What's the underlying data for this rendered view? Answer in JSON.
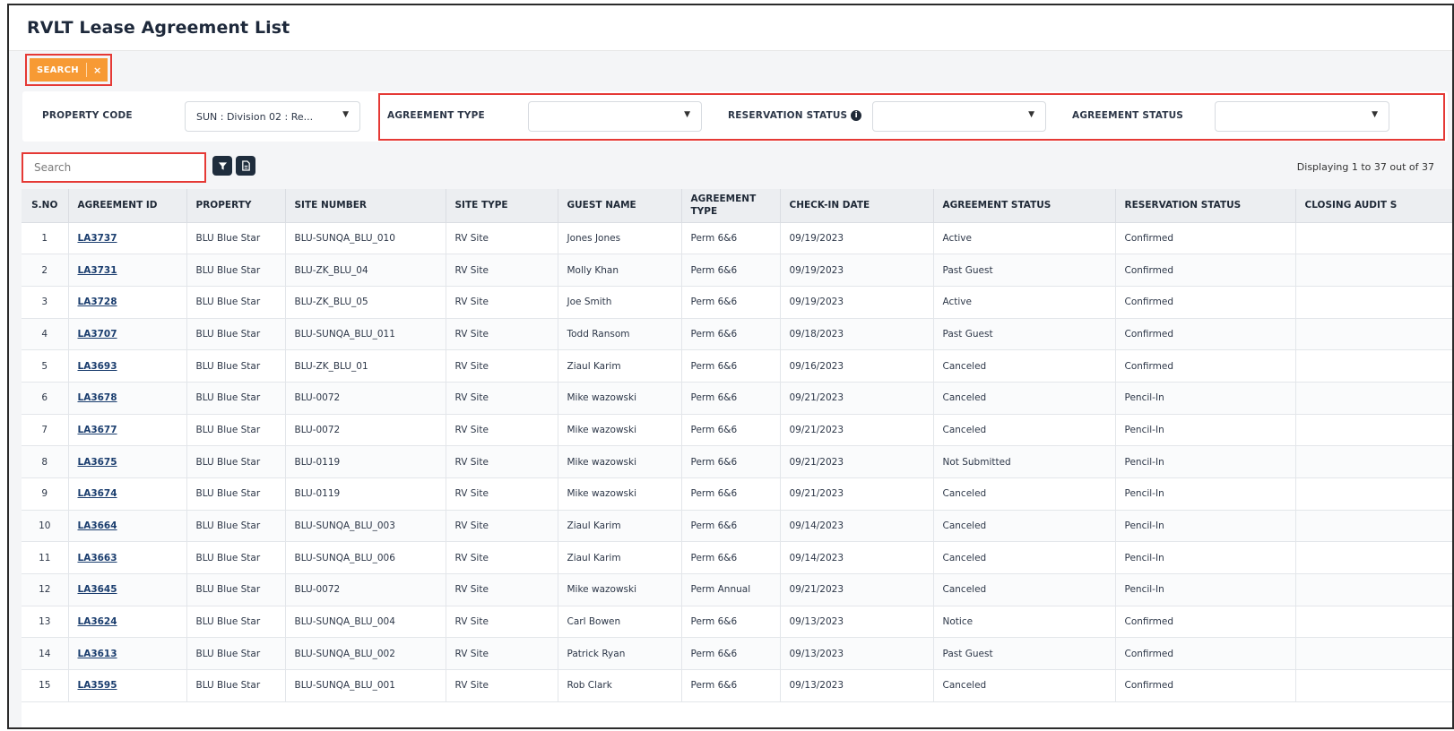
{
  "page": {
    "title": "RVLT Lease Agreement List"
  },
  "search_tab": {
    "label": "SEARCH",
    "close": "×"
  },
  "filters": {
    "property_code": {
      "label": "PROPERTY CODE",
      "value": "SUN : Division 02 : Re..."
    },
    "agreement_type": {
      "label": "AGREEMENT TYPE",
      "value": ""
    },
    "reservation_status": {
      "label": "RESERVATION STATUS",
      "value": ""
    },
    "agreement_status": {
      "label": "AGREEMENT STATUS",
      "value": ""
    }
  },
  "search": {
    "placeholder": "Search"
  },
  "toolbar": {
    "filter_icon": "filter-icon",
    "export_icon": "document-icon"
  },
  "displaying": "Displaying 1 to 37 out of 37",
  "table": {
    "headers": [
      "S.NO",
      "AGREEMENT ID",
      "PROPERTY",
      "SITE NUMBER",
      "SITE TYPE",
      "GUEST NAME",
      "AGREEMENT TYPE",
      "CHECK-IN DATE",
      "AGREEMENT STATUS",
      "RESERVATION STATUS",
      "CLOSING AUDIT S"
    ],
    "rows": [
      [
        "1",
        "LA3737",
        "BLU Blue Star",
        "BLU-SUNQA_BLU_010",
        "RV Site",
        "Jones Jones",
        "Perm 6&6",
        "09/19/2023",
        "Active",
        "Confirmed",
        ""
      ],
      [
        "2",
        "LA3731",
        "BLU Blue Star",
        "BLU-ZK_BLU_04",
        "RV Site",
        "Molly Khan",
        "Perm 6&6",
        "09/19/2023",
        "Past Guest",
        "Confirmed",
        ""
      ],
      [
        "3",
        "LA3728",
        "BLU Blue Star",
        "BLU-ZK_BLU_05",
        "RV Site",
        "Joe Smith",
        "Perm 6&6",
        "09/19/2023",
        "Active",
        "Confirmed",
        ""
      ],
      [
        "4",
        "LA3707",
        "BLU Blue Star",
        "BLU-SUNQA_BLU_011",
        "RV Site",
        "Todd Ransom",
        "Perm 6&6",
        "09/18/2023",
        "Past Guest",
        "Confirmed",
        ""
      ],
      [
        "5",
        "LA3693",
        "BLU Blue Star",
        "BLU-ZK_BLU_01",
        "RV Site",
        "Ziaul Karim",
        "Perm 6&6",
        "09/16/2023",
        "Canceled",
        "Confirmed",
        ""
      ],
      [
        "6",
        "LA3678",
        "BLU Blue Star",
        "BLU-0072",
        "RV Site",
        "Mike wazowski",
        "Perm 6&6",
        "09/21/2023",
        "Canceled",
        "Pencil-In",
        ""
      ],
      [
        "7",
        "LA3677",
        "BLU Blue Star",
        "BLU-0072",
        "RV Site",
        "Mike wazowski",
        "Perm 6&6",
        "09/21/2023",
        "Canceled",
        "Pencil-In",
        ""
      ],
      [
        "8",
        "LA3675",
        "BLU Blue Star",
        "BLU-0119",
        "RV Site",
        "Mike wazowski",
        "Perm 6&6",
        "09/21/2023",
        "Not Submitted",
        "Pencil-In",
        ""
      ],
      [
        "9",
        "LA3674",
        "BLU Blue Star",
        "BLU-0119",
        "RV Site",
        "Mike wazowski",
        "Perm 6&6",
        "09/21/2023",
        "Canceled",
        "Pencil-In",
        ""
      ],
      [
        "10",
        "LA3664",
        "BLU Blue Star",
        "BLU-SUNQA_BLU_003",
        "RV Site",
        "Ziaul Karim",
        "Perm 6&6",
        "09/14/2023",
        "Canceled",
        "Pencil-In",
        ""
      ],
      [
        "11",
        "LA3663",
        "BLU Blue Star",
        "BLU-SUNQA_BLU_006",
        "RV Site",
        "Ziaul Karim",
        "Perm 6&6",
        "09/14/2023",
        "Canceled",
        "Pencil-In",
        ""
      ],
      [
        "12",
        "LA3645",
        "BLU Blue Star",
        "BLU-0072",
        "RV Site",
        "Mike wazowski",
        "Perm Annual",
        "09/21/2023",
        "Canceled",
        "Pencil-In",
        ""
      ],
      [
        "13",
        "LA3624",
        "BLU Blue Star",
        "BLU-SUNQA_BLU_004",
        "RV Site",
        "Carl Bowen",
        "Perm 6&6",
        "09/13/2023",
        "Notice",
        "Confirmed",
        ""
      ],
      [
        "14",
        "LA3613",
        "BLU Blue Star",
        "BLU-SUNQA_BLU_002",
        "RV Site",
        "Patrick Ryan",
        "Perm 6&6",
        "09/13/2023",
        "Past Guest",
        "Confirmed",
        ""
      ],
      [
        "15",
        "LA3595",
        "BLU Blue Star",
        "BLU-SUNQA_BLU_001",
        "RV Site",
        "Rob Clark",
        "Perm 6&6",
        "09/13/2023",
        "Canceled",
        "Confirmed",
        ""
      ]
    ]
  },
  "colors": {
    "accent_orange": "#f79a34",
    "highlight_red": "#e53935",
    "dark_button": "#1f2d3d",
    "link_blue": "#1a3d6e"
  }
}
